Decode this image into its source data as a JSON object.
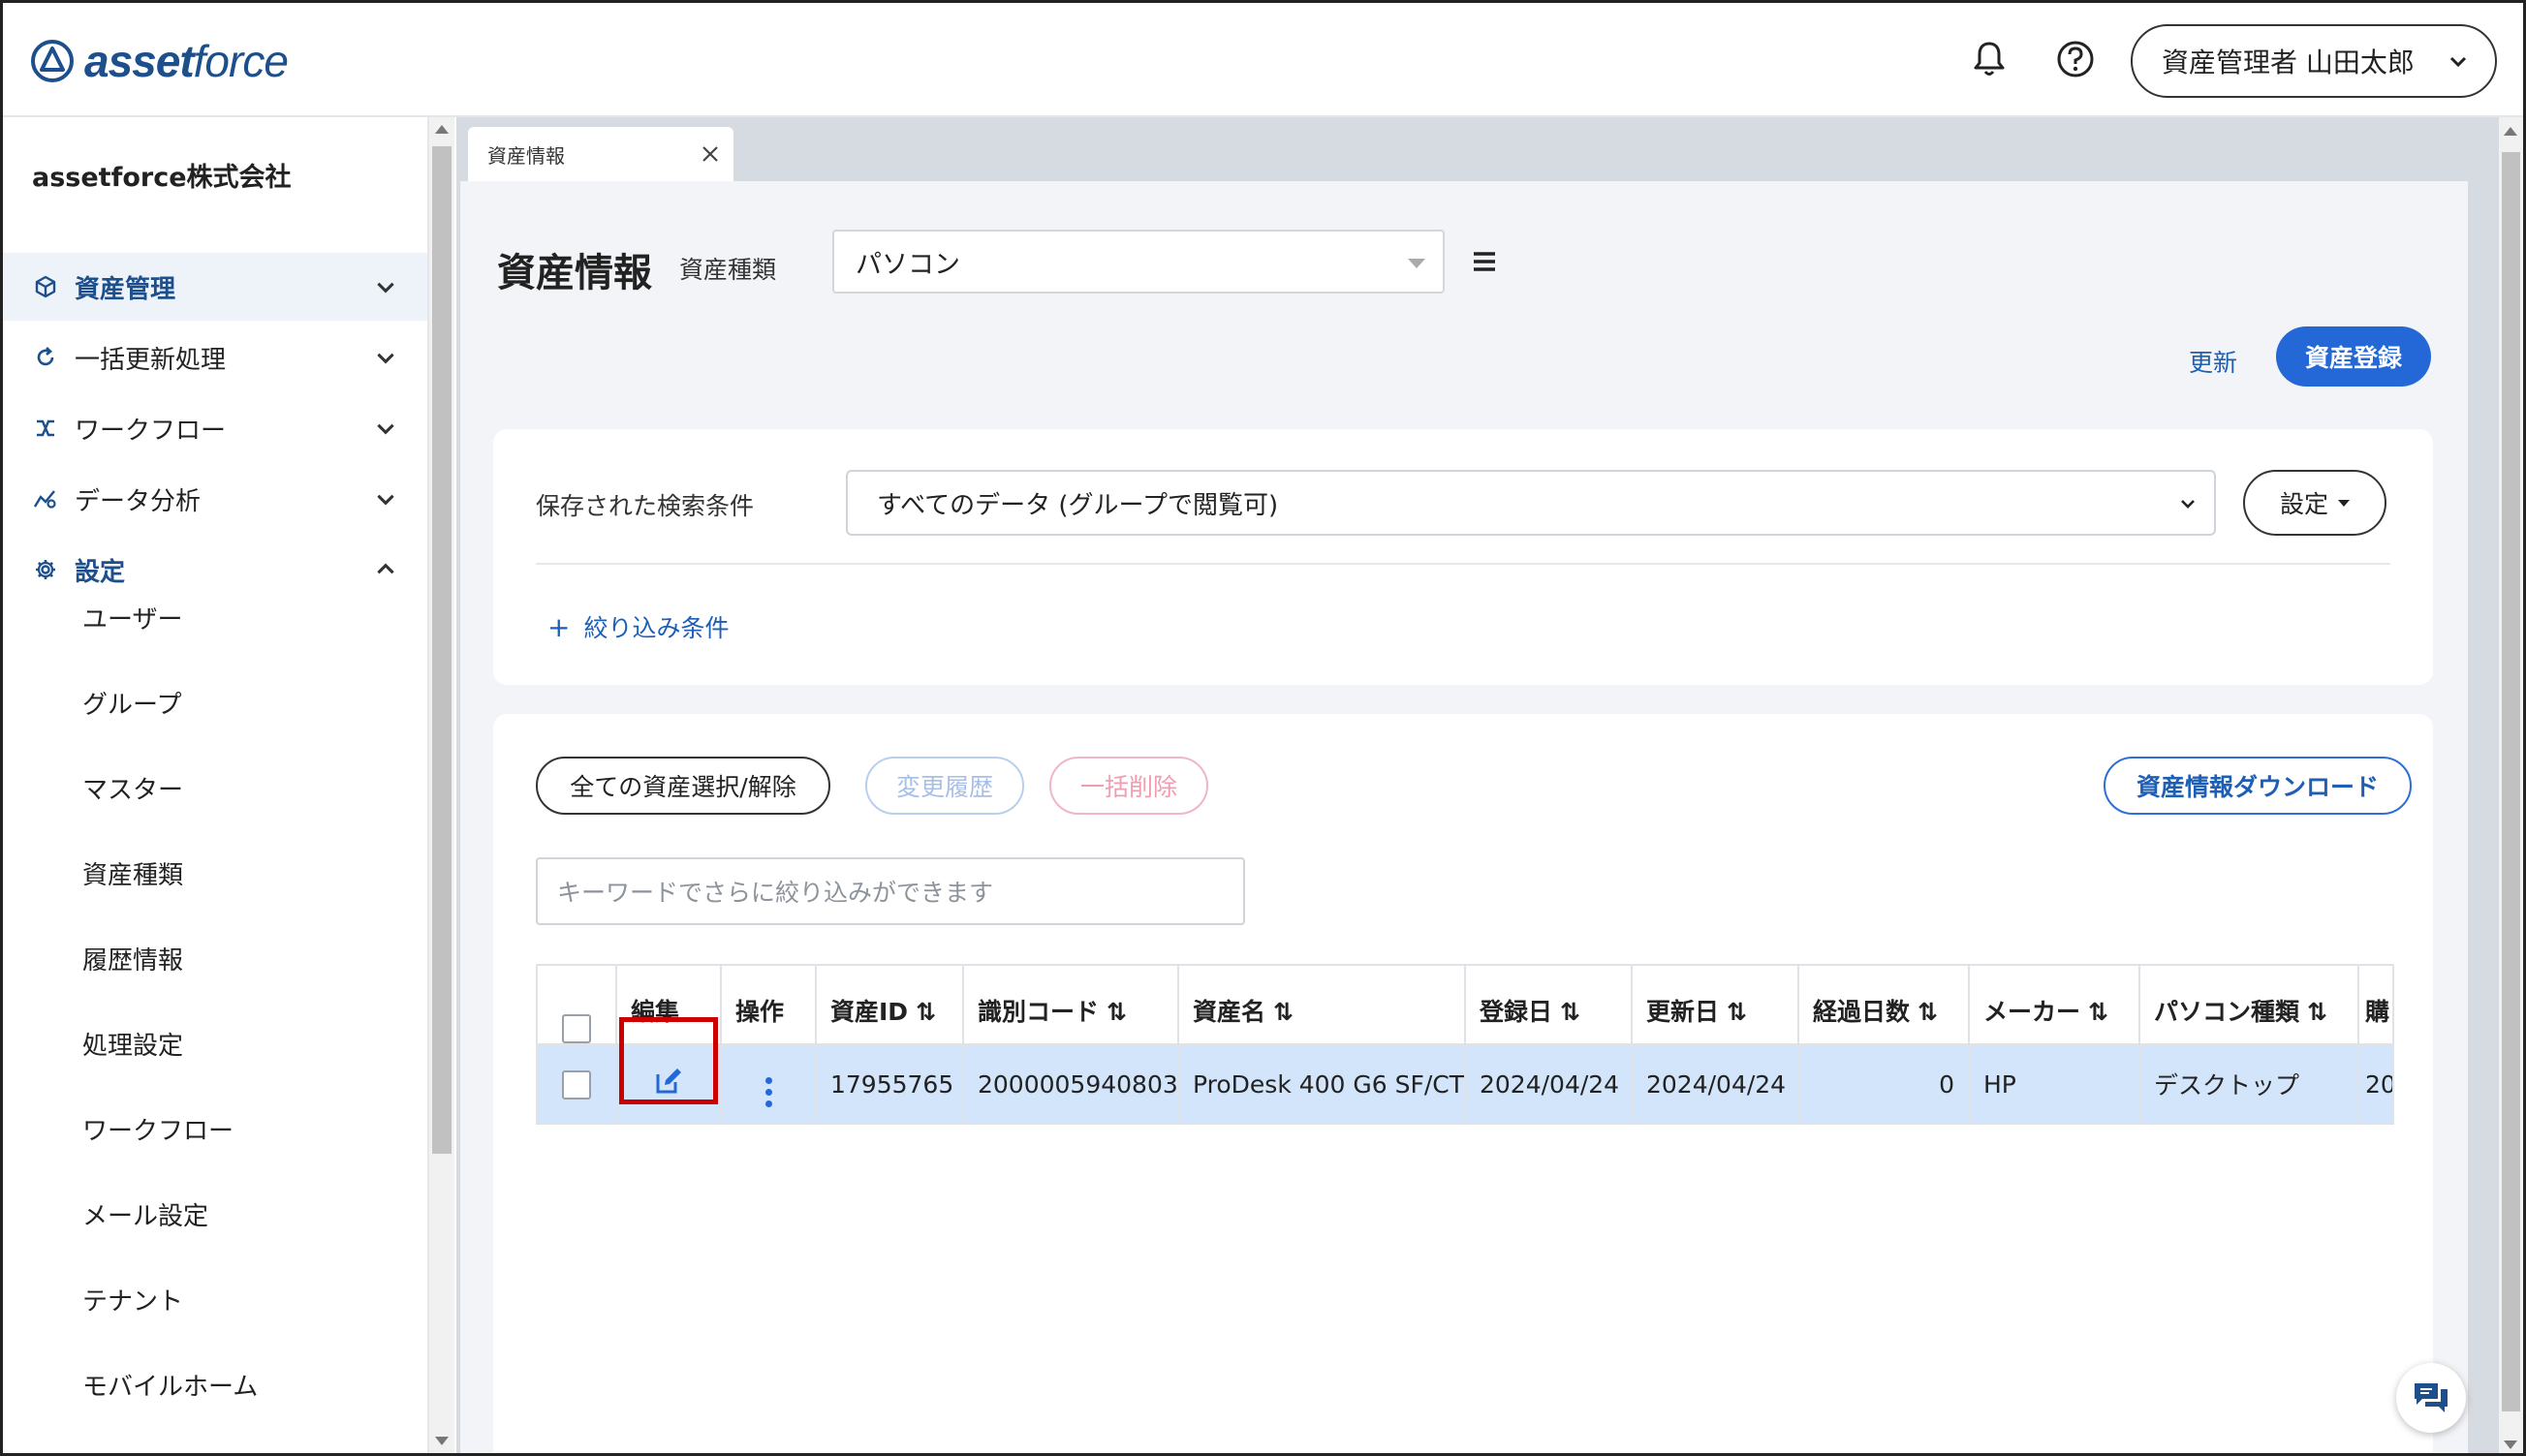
{
  "header": {
    "logo_bold": "asset",
    "logo_light": "force",
    "user_label": "資産管理者 山田太郎"
  },
  "sidebar": {
    "company": "assetforce株式会社",
    "nav": [
      {
        "label": "資産管理",
        "icon": "cube-icon",
        "active": true
      },
      {
        "label": "一括更新処理",
        "icon": "refresh-icon"
      },
      {
        "label": "ワークフロー",
        "icon": "workflow-icon"
      },
      {
        "label": "データ分析",
        "icon": "analytics-icon"
      },
      {
        "label": "設定",
        "icon": "gear-icon"
      }
    ],
    "settings_items": [
      "ユーザー",
      "グループ",
      "マスター",
      "資産種類",
      "履歴情報",
      "処理設定",
      "ワークフロー",
      "メール設定",
      "テナント",
      "モバイルホーム"
    ]
  },
  "tab": {
    "label": "資産情報"
  },
  "page": {
    "title": "資産情報",
    "type_label": "資産種類",
    "type_value": "パソコン",
    "refresh_label": "更新",
    "register_label": "資産登録"
  },
  "search": {
    "saved_label": "保存された検索条件",
    "saved_value": "すべてのデータ (グループで閲覧可)",
    "settings_label": "設定",
    "filter_label": "絞り込み条件"
  },
  "toolbar": {
    "select_all": "全ての資産選択/解除",
    "history": "変更履歴",
    "bulk_delete": "一括削除",
    "download": "資産情報ダウンロード",
    "keyword_placeholder": "キーワードでさらに絞り込みができます"
  },
  "table": {
    "headers": [
      "編集",
      "操作",
      "資産ID",
      "識別コード",
      "資産名",
      "登録日",
      "更新日",
      "経過日数",
      "メーカー",
      "パソコン種類",
      "購"
    ],
    "rows": [
      {
        "asset_id": "17955765",
        "code": "2000005940803",
        "name": "ProDesk 400 G6 SF/CT",
        "registered": "2024/04/24",
        "updated": "2024/04/24",
        "elapsed": "0",
        "maker": "HP",
        "pc_type": "デスクトップ",
        "more": "20"
      }
    ]
  },
  "colors": {
    "accent": "#2368d6",
    "brand": "#1d4f8c",
    "highlight": "#cc0000",
    "row_selected": "#d3e5fb"
  }
}
